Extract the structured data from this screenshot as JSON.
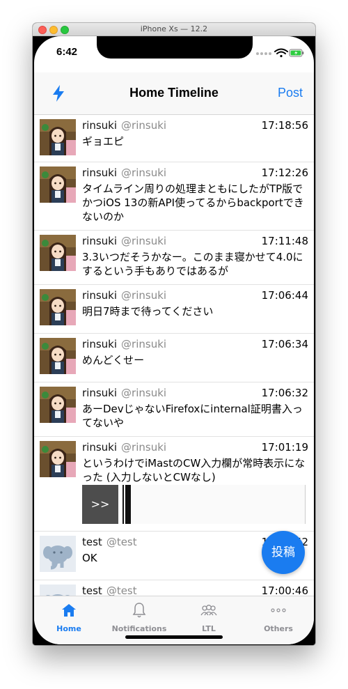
{
  "window": {
    "title": "iPhone Xs — 12.2"
  },
  "status_bar": {
    "time": "6:42"
  },
  "nav": {
    "title": "Home Timeline",
    "post_label": "Post"
  },
  "colors": {
    "accent": "#1a7cf0",
    "inactive": "#8e8e93"
  },
  "posts": [
    {
      "user": "rinsuki",
      "acct": "@rinsuki",
      "time": "17:18:56",
      "text": "ギョエピ",
      "avatar": "anime-avatar"
    },
    {
      "user": "rinsuki",
      "acct": "@rinsuki",
      "time": "17:12:26",
      "text": "タイムライン周りの処理まともにしたがTP版でかつiOS 13の新API使ってるからbackportできないのか",
      "avatar": "anime-avatar"
    },
    {
      "user": "rinsuki",
      "acct": "@rinsuki",
      "time": "17:11:48",
      "text": "3.3いつだそうかなー。このまま寝かせて4.0にするという手もありではあるが",
      "avatar": "anime-avatar"
    },
    {
      "user": "rinsuki",
      "acct": "@rinsuki",
      "time": "17:06:44",
      "text": "明日7時まで待ってください",
      "avatar": "anime-avatar"
    },
    {
      "user": "rinsuki",
      "acct": "@rinsuki",
      "time": "17:06:34",
      "text": "めんどくせー",
      "avatar": "anime-avatar"
    },
    {
      "user": "rinsuki",
      "acct": "@rinsuki",
      "time": "17:06:32",
      "text": "あーDevじゃないFirefoxにinternal証明書入ってないや",
      "avatar": "anime-avatar"
    },
    {
      "user": "rinsuki",
      "acct": "@rinsuki",
      "time": "17:01:19",
      "text": "というわけでiMastのCW入力欄が常時表示になった (入力しないとCWなし)",
      "avatar": "anime-avatar",
      "media_label": ">>"
    },
    {
      "user": "test",
      "acct": "@test",
      "time": "17:00:52",
      "text": "OK",
      "avatar": "mastodon-elephant"
    },
    {
      "user": "test",
      "acct": "@test",
      "time": "17:00:46",
      "text": "",
      "avatar": "mastodon-elephant"
    }
  ],
  "fab": {
    "label": "投稿"
  },
  "tabs": [
    {
      "label": "Home",
      "icon": "home-icon",
      "active": true
    },
    {
      "label": "Notifications",
      "icon": "bell-icon",
      "active": false
    },
    {
      "label": "LTL",
      "icon": "people-icon",
      "active": false
    },
    {
      "label": "Others",
      "icon": "more-icon",
      "active": false
    }
  ]
}
